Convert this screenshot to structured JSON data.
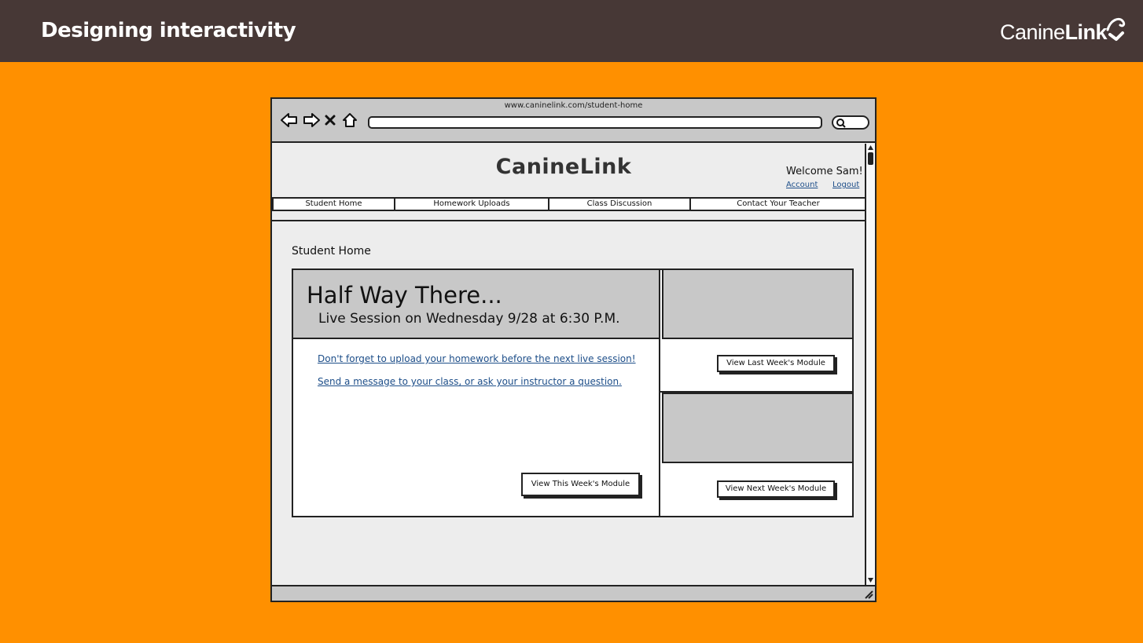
{
  "slide": {
    "title": "Designing interactivity",
    "logo_light": "Canine",
    "logo_bold": "Link"
  },
  "browser": {
    "url": "www.caninelink.com/student-home",
    "nav_icons": [
      "back-arrow-icon",
      "forward-arrow-icon",
      "close-x-icon",
      "home-icon"
    ],
    "search_icon": "search-icon"
  },
  "site": {
    "logo": "CanineLink",
    "welcome": "Welcome Sam!",
    "account_link": "Account",
    "logout_link": "Logout",
    "tabs": [
      {
        "label": "Student Home"
      },
      {
        "label": "Homework Uploads"
      },
      {
        "label": "Class Discussion"
      },
      {
        "label": "Contact Your Teacher"
      }
    ]
  },
  "page": {
    "heading": "Student Home",
    "hero_title": "Half Way There...",
    "hero_subtitle": "Live Session on Wednesday 9/28 at 6:30 P.M.",
    "link_homework": "Don't forget to upload your homework before the next live session!",
    "link_message": "Send a message to your class, or ask your instructor a question.",
    "btn_this_week": "View This Week's Module",
    "btn_last_week": "View Last Week's Module",
    "btn_next_week": "View Next Week's Module"
  },
  "colors": {
    "slide_background": "#ff9000",
    "header_bar": "#473836",
    "mockup_gray": "#c8c8c8",
    "link_blue": "#1d4e89"
  }
}
